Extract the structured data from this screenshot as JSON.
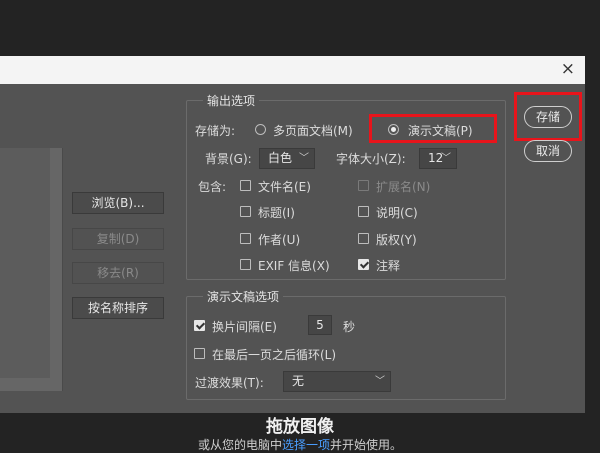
{
  "background": {
    "heading": "拖放图像",
    "sub_prefix": "或从您的电脑中",
    "sub_link": "选择一项",
    "sub_suffix": "并开始使用。"
  },
  "dialog": {
    "close_icon": "×",
    "side_buttons": {
      "browse": "浏览(B)...",
      "copy": "复制(D)",
      "remove": "移去(R)",
      "sort": "按名称排序"
    },
    "output_options": {
      "legend": "输出选项",
      "save_as_label": "存储为:",
      "multipage_label": "多页面文档(M)",
      "presentation_label": "演示文稿(P)",
      "selected": "presentation",
      "background_label": "背景(G):",
      "background_value": "白色",
      "font_size_label": "字体大小(Z):",
      "font_size_value": "12",
      "include_label": "包含:",
      "includes": {
        "filename": "文件名(E)",
        "extension": "扩展名(N)",
        "title": "标题(I)",
        "description": "说明(C)",
        "author": "作者(U)",
        "copyright": "版权(Y)",
        "exif": "EXIF 信息(X)",
        "annotations": "注释"
      },
      "annotations_checked": true
    },
    "presentation_options": {
      "legend": "演示文稿选项",
      "advance_label": "换片间隔(E)",
      "advance_checked": true,
      "advance_value": "5",
      "seconds_label": "秒",
      "loop_label": "在最后一页之后循环(L)",
      "loop_checked": false,
      "transition_label": "过渡效果(T):",
      "transition_value": "无"
    },
    "actions": {
      "save": "存储",
      "cancel": "取消"
    },
    "highlight_color": "#e8141b"
  }
}
